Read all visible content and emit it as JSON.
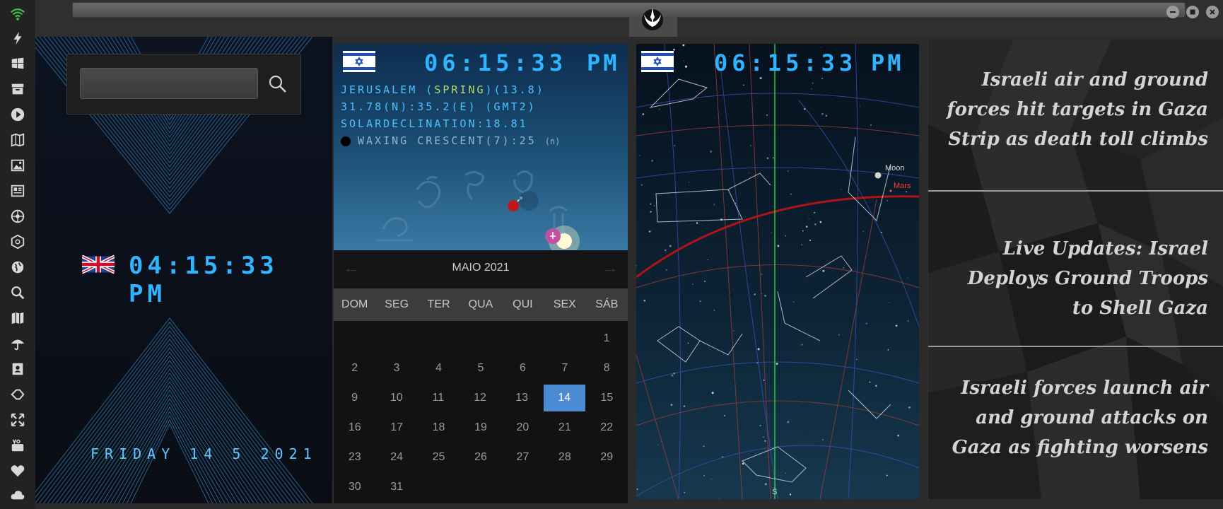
{
  "sidebar": {
    "icons": [
      "wifi-icon",
      "power-icon",
      "windows-icon",
      "archive-icon",
      "play-icon",
      "map-book-icon",
      "image-icon",
      "news-icon",
      "rebel-icon",
      "empire-icon",
      "globe-icon",
      "search-icon",
      "map-icon",
      "umbrella-icon",
      "contacts-icon",
      "tag-icon",
      "expand-icon",
      "youtube-icon",
      "heart-icon",
      "cloud-icon"
    ],
    "accent": "#3ec14a"
  },
  "window": {
    "logo": "rebel-alliance-logo"
  },
  "uk_clock": {
    "time": "04:15:33 PM",
    "date": "FRIDAY 14 5 2021",
    "flag": "uk-flag"
  },
  "jerusalem": {
    "time": "06:15:33",
    "ampm": "PM",
    "line1_a": "JERUSALEM (",
    "line1_season": "SPRING",
    "line1_b": ")(13.8)",
    "line2": "31.78(N):35.2(E) (GMT2)",
    "line3": "SOLARDECLINATION:18.81",
    "moon": "WAXING CRESCENT(7):25",
    "moon_suffix": "(n)"
  },
  "calendar": {
    "month": "MAIO 2021",
    "days": [
      "DOM",
      "SEG",
      "TER",
      "QUA",
      "QUI",
      "SEX",
      "SÁB"
    ],
    "weeks": [
      [
        "",
        "",
        "",
        "",
        "",
        "",
        "1"
      ],
      [
        "2",
        "3",
        "4",
        "5",
        "6",
        "7",
        "8"
      ],
      [
        "9",
        "10",
        "11",
        "12",
        "13",
        "14",
        "15"
      ],
      [
        "16",
        "17",
        "18",
        "19",
        "20",
        "21",
        "22"
      ],
      [
        "23",
        "24",
        "25",
        "26",
        "27",
        "28",
        "29"
      ],
      [
        "30",
        "31",
        "",
        "",
        "",
        "",
        ""
      ]
    ],
    "selected": "14",
    "selected_color": "#4a8bd4"
  },
  "skymap": {
    "time": "06:15:33",
    "ampm": "PM",
    "labels": {
      "moon": "Moon",
      "mars": "Mars",
      "south": "S"
    }
  },
  "news": {
    "items": [
      "Israeli air and ground forces hit targets in Gaza Strip as death toll climbs",
      "Live Updates: Israel Deploys Ground Troops to Shell Gaza",
      "Israeli forces launch air and ground attacks on Gaza as fighting worsens"
    ]
  }
}
